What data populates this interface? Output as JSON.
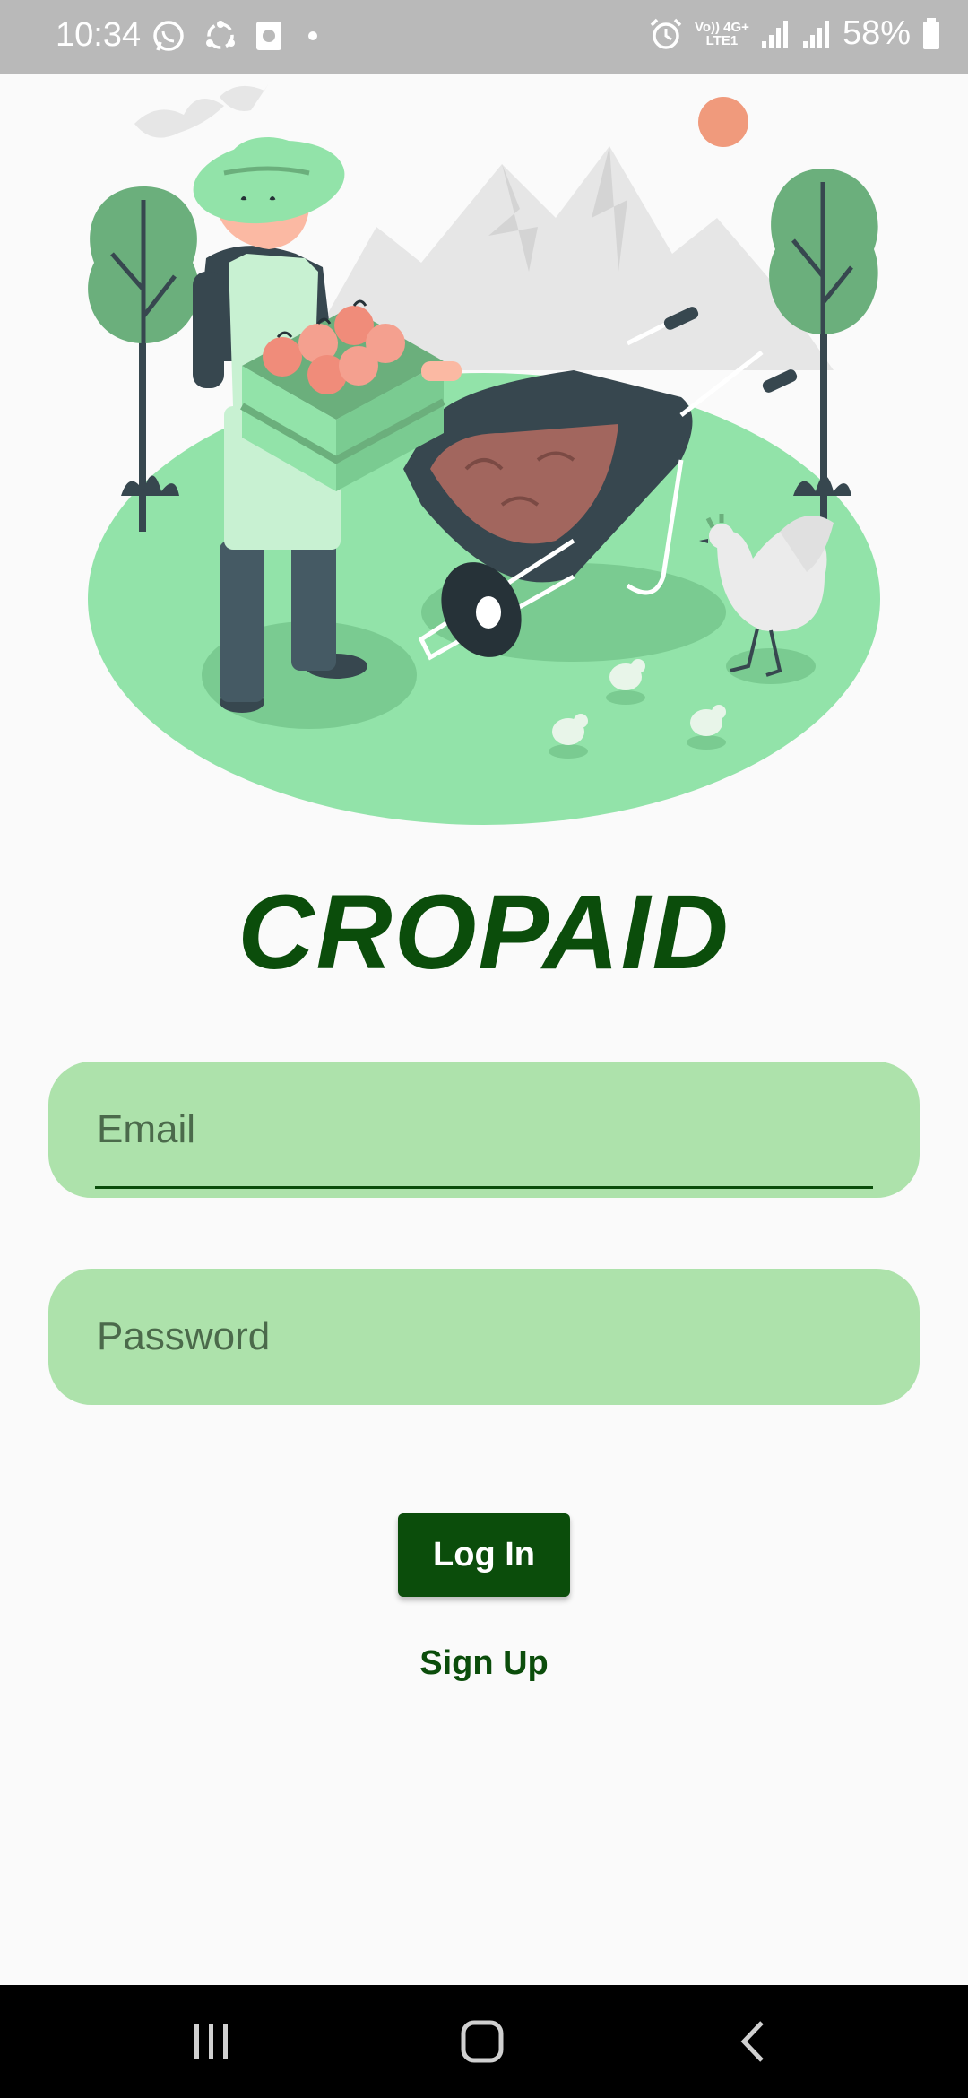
{
  "status_bar": {
    "time": "10:34",
    "battery": "58%",
    "network_top": "Vo)) 4G+",
    "network_bottom": "LTE1",
    "icons": [
      "whatsapp-icon",
      "sync-icon",
      "notification-icon",
      "dot-icon",
      "alarm-icon",
      "signal-icon",
      "signal-icon",
      "battery-icon"
    ]
  },
  "app": {
    "title": "CROPAID"
  },
  "form": {
    "email_placeholder": "Email",
    "password_placeholder": "Password",
    "login_label": "Log In",
    "signup_label": "Sign Up"
  },
  "nav_bar": {
    "buttons": [
      "recents-icon",
      "home-icon",
      "back-icon"
    ]
  },
  "colors": {
    "brand_green": "#0b4d0b",
    "field_green": "#ade2ab",
    "ground_green": "#92e3a9"
  }
}
